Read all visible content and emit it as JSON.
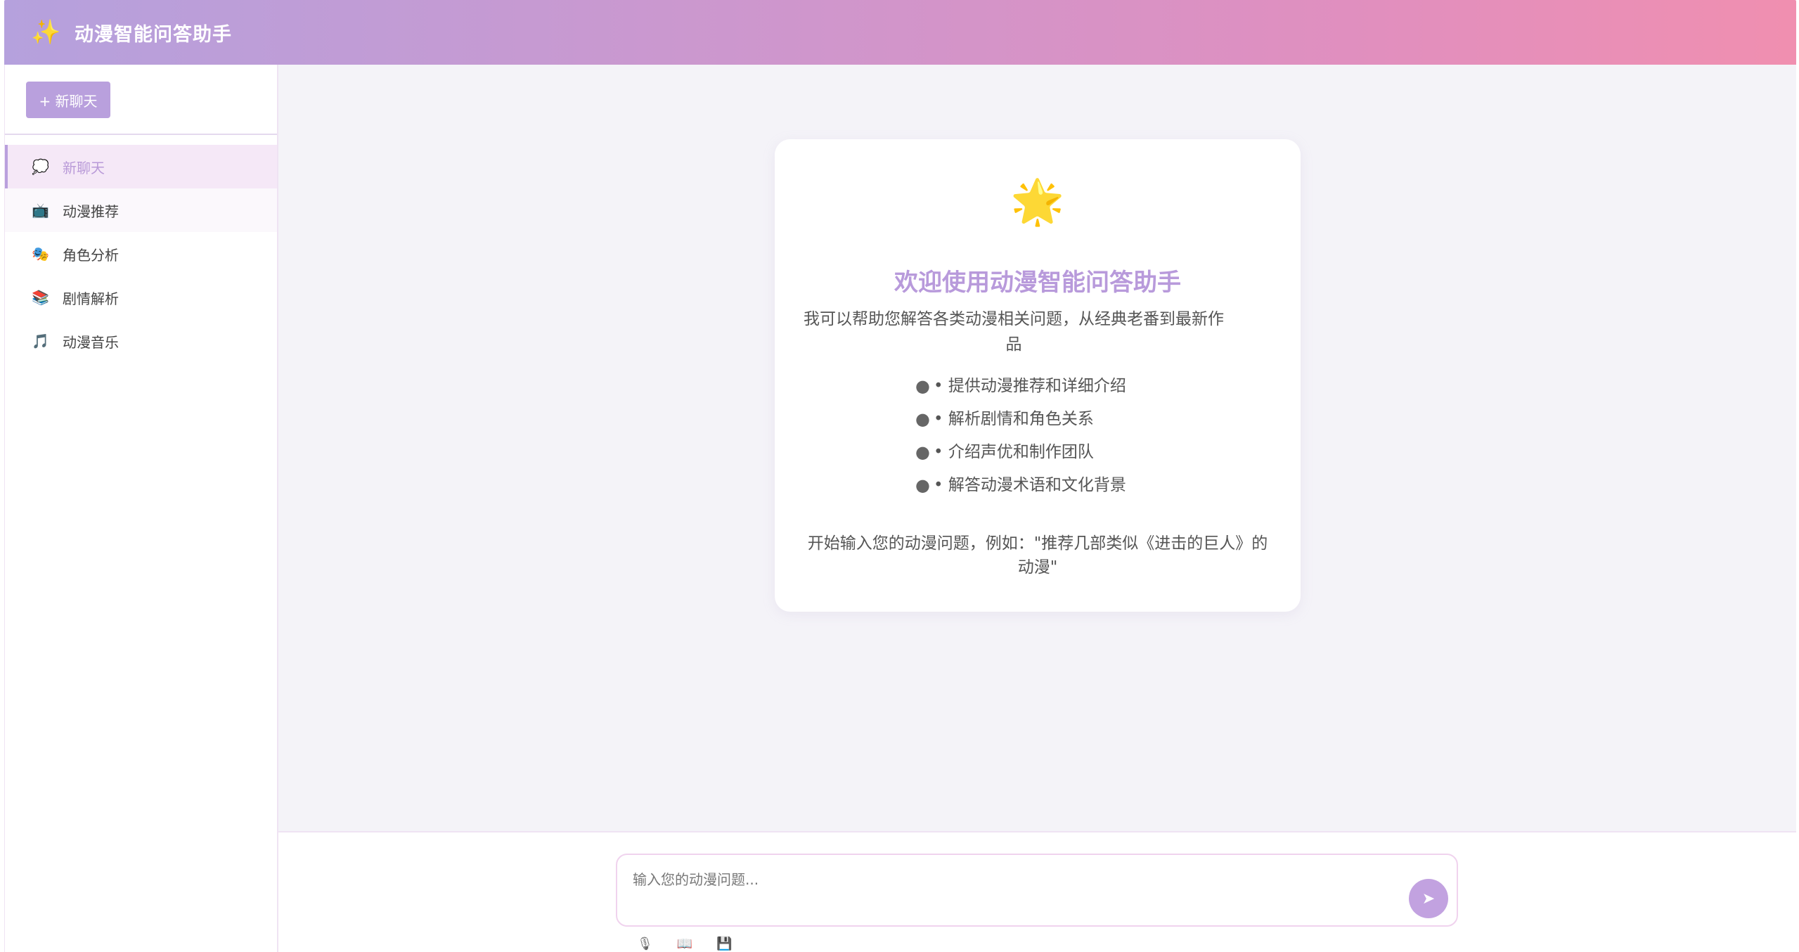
{
  "header": {
    "logo_icon": "✨",
    "title": "动漫智能问答助手"
  },
  "sidebar": {
    "new_chat_label": "+ 新聊天",
    "items": [
      {
        "icon": "💭",
        "label": "新聊天"
      },
      {
        "icon": "📺",
        "label": "动漫推荐"
      },
      {
        "icon": "🎭",
        "label": "角色分析"
      },
      {
        "icon": "📚",
        "label": "剧情解析"
      },
      {
        "icon": "🎵",
        "label": "动漫音乐"
      }
    ]
  },
  "welcome": {
    "icon": "🌟",
    "title": "欢迎使用动漫智能问答助手",
    "description": "我可以帮助您解答各类动漫相关问题，从经典老番到最新作品",
    "features": [
      "• 提供动漫推荐和详细介绍",
      "• 解析剧情和角色关系",
      "• 介绍声优和制作团队",
      "• 解答动漫术语和文化背景"
    ],
    "hint": "开始输入您的动漫问题，例如：\"推荐几部类似《进击的巨人》的动漫\""
  },
  "input": {
    "placeholder": "输入您的动漫问题...",
    "send_icon": "➤",
    "tools": [
      "🎙",
      "📖",
      "💾"
    ]
  },
  "colors": {
    "accent": "#b9a0dd",
    "title_purple": "#b89adb",
    "active_bg": "#f5e8f7",
    "header_start": "#b5a1dd",
    "header_end": "#f08fb0"
  }
}
